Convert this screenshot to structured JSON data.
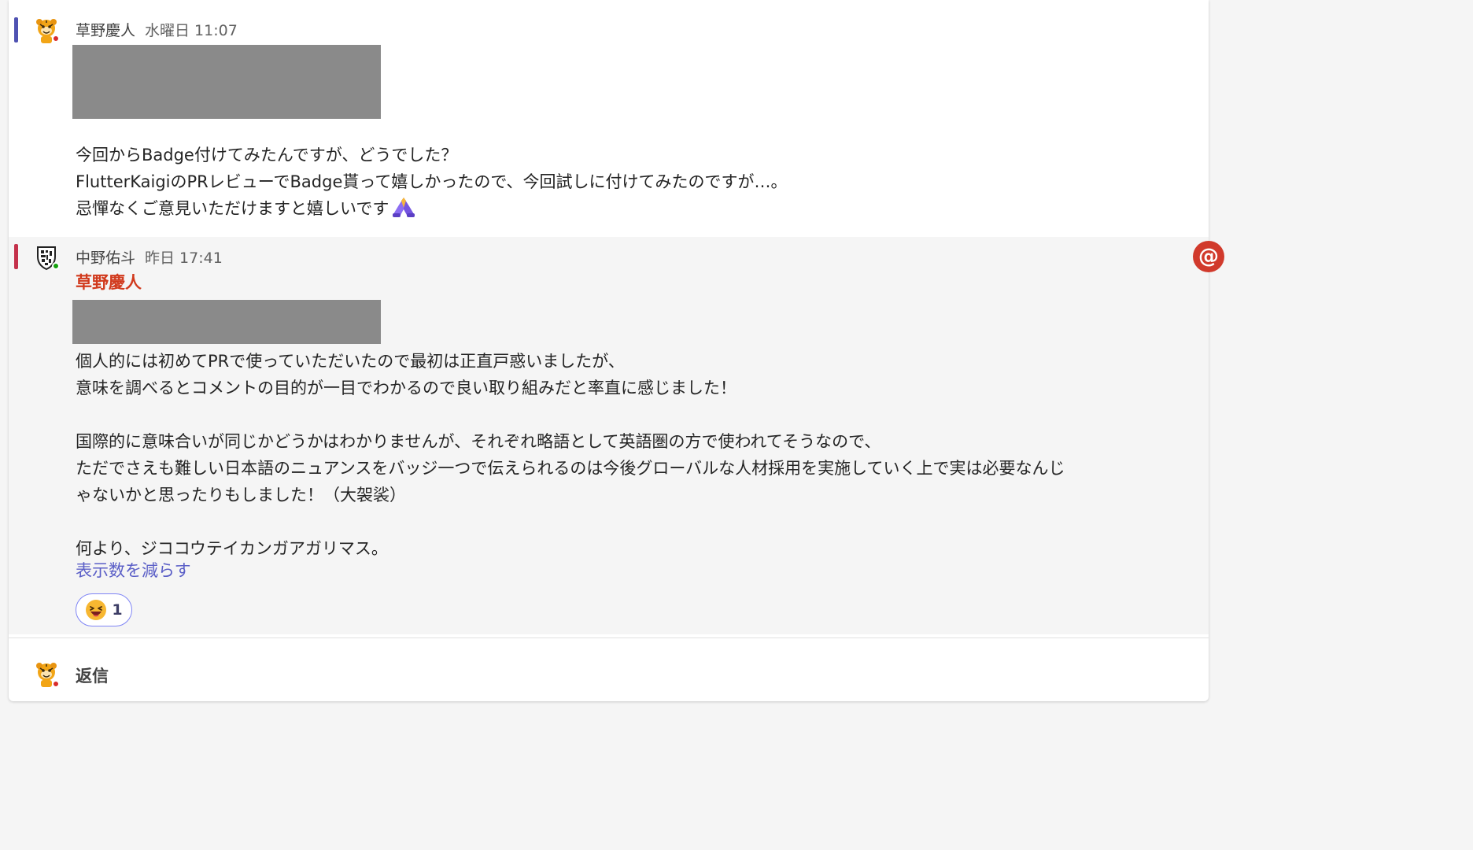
{
  "colors": {
    "accent_first_message": "#4f52b2",
    "accent_second_message": "#c4314b",
    "mention_color": "#d13a1d",
    "link_color": "#5b5fc7",
    "status_busy": "#d92c2c",
    "status_available": "#13a10e"
  },
  "messages": [
    {
      "author": "草野慶人",
      "time": "水曜日 11:07",
      "status": "busy",
      "lines": [
        "今回からBadge付けてみたんですが、どうでした？",
        "FlutterKaigiのPRレビューでBadge貰って嬉しかったので、今回試しに付けてみたのですが…。",
        "忌憚なくご意見いただけますと嬉しいです"
      ],
      "trailing_emoji": "folded-hands-icon"
    },
    {
      "author": "中野佑斗",
      "time": "昨日 17:41",
      "status": "available",
      "mention": "草野慶人",
      "lines": [
        "個人的には初めてPRで使っていただいたので最初は正直戸惑いましたが、",
        "意味を調べるとコメントの目的が一目でわかるので良い取り組みだと率直に感じました！",
        "",
        "国際的に意味合いが同じかどうかはわかりませんが、それぞれ略語として英語圏の方で使われてそうなので、",
        "ただでさえも難しい日本語のニュアンスをバッジ一つで伝えられるのは今後グローバルな人材採用を実施していく上で実は必要なんじ",
        "ゃないかと思ったりもしました！（大袈裟）",
        "",
        "何より、ジココウテイカンガアガリマス。"
      ],
      "show_less": "表示数を減らす",
      "reaction": {
        "emoji": "laughing-face-icon",
        "count": "1"
      }
    }
  ],
  "reply": {
    "label": "返信"
  },
  "mention_indicator": {
    "symbol": "@"
  }
}
